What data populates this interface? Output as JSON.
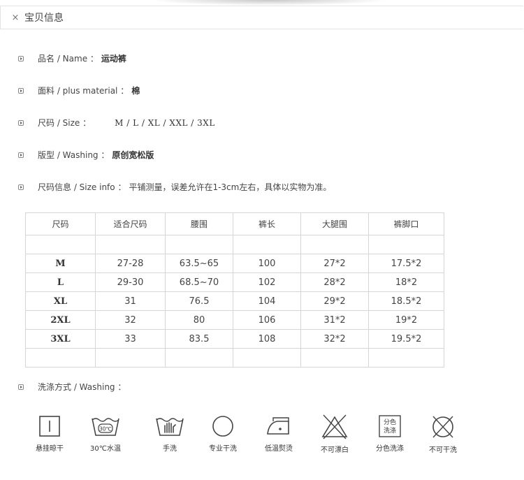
{
  "header": {
    "close_symbol": "×",
    "title": "宝贝信息"
  },
  "info": [
    {
      "label": "品名 / Name ：",
      "value": "运动裤"
    },
    {
      "label": "面料 / plus material ：",
      "value": "棉"
    },
    {
      "label": "尺码 / Size ：",
      "value": "M / L / XL / XXL / 3XL"
    },
    {
      "label": "版型 / Washing ：",
      "value": "原创宽松版"
    },
    {
      "label": "尺码信息 / Size info ：",
      "value": "平铺测量，误差允许在1-3cm左右，具体以实物为准。"
    }
  ],
  "table": {
    "headers": [
      "尺码",
      "适合尺码",
      "腰围",
      "裤长",
      "大腿围",
      "裤脚口"
    ],
    "rows": [
      [
        "M",
        "27-28",
        "63.5~65",
        "100",
        "27*2",
        "17.5*2"
      ],
      [
        "L",
        "29-30",
        "68.5~70",
        "102",
        "28*2",
        "18*2"
      ],
      [
        "XL",
        "31",
        "76.5",
        "104",
        "29*2",
        "18.5*2"
      ],
      [
        "2XL",
        "32",
        "80",
        "106",
        "31*2",
        "19*2"
      ],
      [
        "3XL",
        "33",
        "83.5",
        "108",
        "32*2",
        "19.5*2"
      ]
    ]
  },
  "washing": {
    "label": "洗涤方式 / Washing ：",
    "icons": [
      {
        "name": "hang-dry-icon",
        "caption": "悬挂晾干"
      },
      {
        "name": "wash-30-icon",
        "caption": "30℃水温",
        "symbol_text": "30℃"
      },
      {
        "name": "hand-wash-icon",
        "caption": "手洗"
      },
      {
        "name": "dry-clean-icon",
        "caption": "专业干洗"
      },
      {
        "name": "iron-low-icon",
        "caption": "低温熨烫"
      },
      {
        "name": "no-bleach-icon",
        "caption": "不可漂白"
      },
      {
        "name": "separate-wash-icon",
        "caption": "分色洗涤",
        "symbol_text_1": "分色",
        "symbol_text_2": "洗涤"
      },
      {
        "name": "no-tumble-dry-icon",
        "caption": "不可干洗"
      }
    ]
  }
}
